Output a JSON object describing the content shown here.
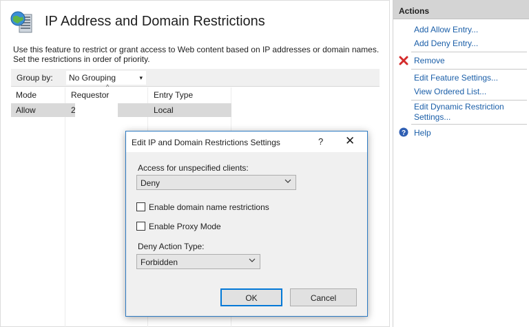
{
  "feature": {
    "title": "IP Address and Domain Restrictions",
    "description_line1": "Use this feature to restrict or grant access to Web content based on IP addresses or domain names.",
    "description_line2": "Set the restrictions in order of priority.",
    "icon": "globe-server-icon"
  },
  "groupbar": {
    "label": "Group by:",
    "value": "No Grouping"
  },
  "grid": {
    "columns": [
      "Mode",
      "Requestor",
      "Entry Type"
    ],
    "rows": [
      {
        "mode": "Allow",
        "requestor": "2",
        "entry_type": "Local"
      }
    ]
  },
  "actions": {
    "header": "Actions",
    "items": [
      {
        "label": "Add Allow Entry...",
        "icon": ""
      },
      {
        "label": "Add Deny Entry...",
        "icon": ""
      },
      {
        "label": "Remove",
        "icon": "red-x-icon"
      },
      {
        "label": "Edit Feature Settings...",
        "icon": ""
      },
      {
        "label": "View Ordered List...",
        "icon": ""
      },
      {
        "label": "Edit Dynamic Restriction",
        "label2": "Settings...",
        "icon": ""
      },
      {
        "label": "Help",
        "icon": "help-icon"
      }
    ]
  },
  "dialog": {
    "title": "Edit IP and Domain Restrictions Settings",
    "help_glyph": "?",
    "close_glyph": "✕",
    "access_label": "Access for unspecified clients:",
    "access_value": "Deny",
    "enable_domain_label": "Enable domain name restrictions",
    "enable_domain_checked": false,
    "enable_proxy_label": "Enable Proxy Mode",
    "enable_proxy_checked": false,
    "deny_action_label": "Deny Action Type:",
    "deny_action_value": "Forbidden",
    "ok_label": "OK",
    "cancel_label": "Cancel"
  },
  "colors": {
    "link": "#1a5ea8",
    "dialog_border": "#2b79c2",
    "selected_row": "#d9d9d9",
    "actions_header": "#d4d4d4"
  }
}
